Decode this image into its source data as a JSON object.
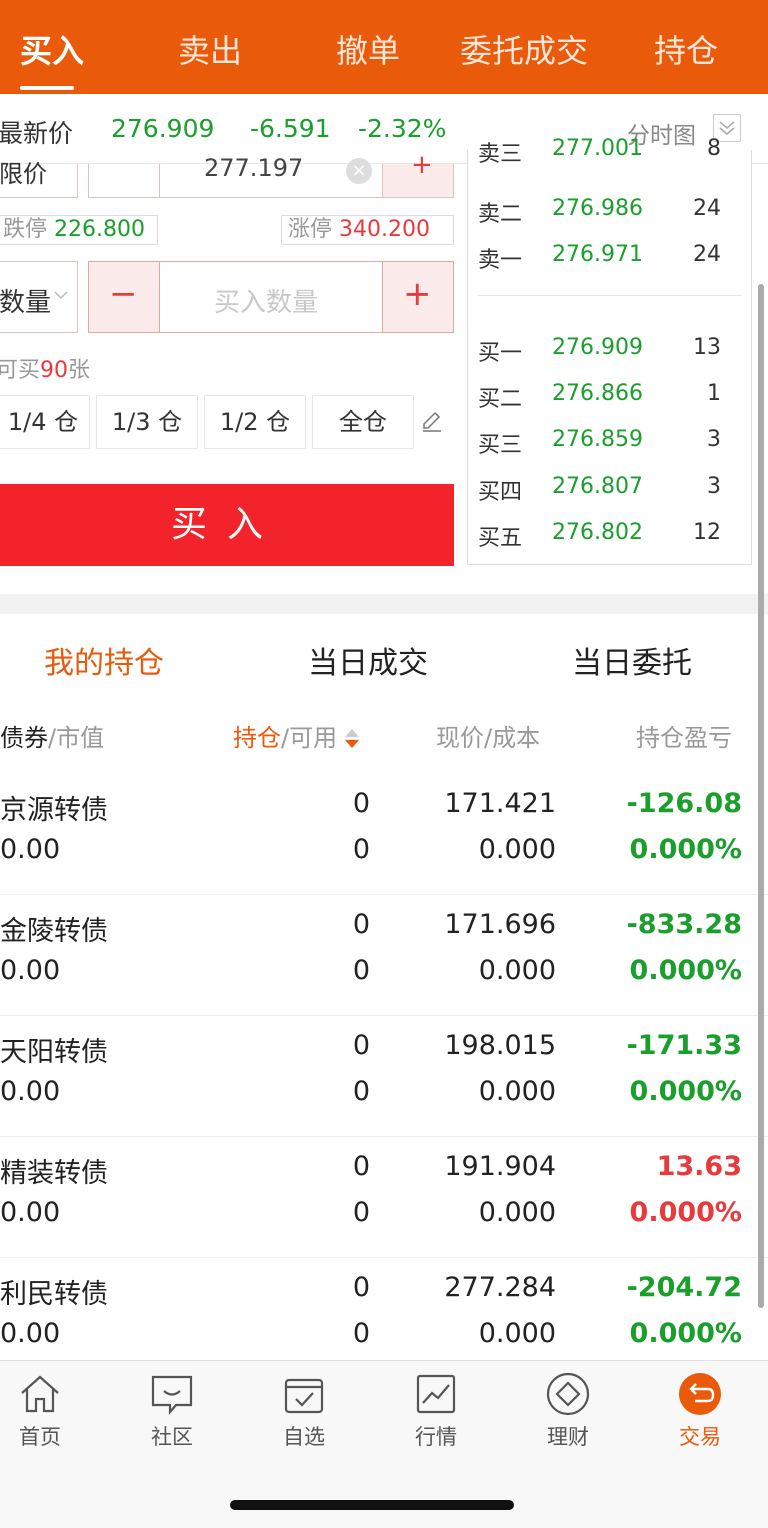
{
  "top_tabs": [
    "买入",
    "卖出",
    "撤单",
    "委托成交",
    "持仓"
  ],
  "quote": {
    "label": "最新价",
    "price": "276.909",
    "change": "-6.591",
    "change_pct": "-2.32%",
    "chart_link": "分时图"
  },
  "order_form": {
    "price_type": "限价",
    "price_value": "277.197",
    "clear_symbol": "×",
    "minus_symbol": "−",
    "plus_symbol": "+",
    "limit_down_label": "跌停",
    "limit_down_value": "226.800",
    "limit_up_label": "涨停",
    "limit_up_value": "340.200",
    "qty_type": "数量",
    "qty_placeholder": "买入数量",
    "can_buy_prefix": "可买",
    "can_buy_count": "90",
    "can_buy_unit": "张",
    "ratios": [
      "1/4 仓",
      "1/3 仓",
      "1/2 仓",
      "全仓"
    ],
    "buy_button": "买入"
  },
  "order_book": {
    "asks": [
      {
        "label": "卖三",
        "price": "277.001",
        "volume": "8"
      },
      {
        "label": "卖二",
        "price": "276.986",
        "volume": "24"
      },
      {
        "label": "卖一",
        "price": "276.971",
        "volume": "24"
      }
    ],
    "bids": [
      {
        "label": "买一",
        "price": "276.909",
        "volume": "13"
      },
      {
        "label": "买二",
        "price": "276.866",
        "volume": "1"
      },
      {
        "label": "买三",
        "price": "276.859",
        "volume": "3"
      },
      {
        "label": "买四",
        "price": "276.807",
        "volume": "3"
      },
      {
        "label": "买五",
        "price": "276.802",
        "volume": "12"
      }
    ]
  },
  "holdings": {
    "tabs": [
      "我的持仓",
      "当日成交",
      "当日委托"
    ],
    "headers": {
      "bond": "债券",
      "mkt_value": "市值",
      "position": "持仓",
      "available": "可用",
      "price": "现价",
      "cost": "成本",
      "pl": "持仓盈亏",
      "sep": "/"
    },
    "rows": [
      {
        "name": "京源转债",
        "mkt_value": "0.00",
        "position": "0",
        "available": "0",
        "price": "171.421",
        "cost": "0.000",
        "pl": "-126.08",
        "pl_pct": "0.000%",
        "sign": "neg"
      },
      {
        "name": "金陵转债",
        "mkt_value": "0.00",
        "position": "0",
        "available": "0",
        "price": "171.696",
        "cost": "0.000",
        "pl": "-833.28",
        "pl_pct": "0.000%",
        "sign": "neg"
      },
      {
        "name": "天阳转债",
        "mkt_value": "0.00",
        "position": "0",
        "available": "0",
        "price": "198.015",
        "cost": "0.000",
        "pl": "-171.33",
        "pl_pct": "0.000%",
        "sign": "neg"
      },
      {
        "name": "精装转债",
        "mkt_value": "0.00",
        "position": "0",
        "available": "0",
        "price": "191.904",
        "cost": "0.000",
        "pl": "13.63",
        "pl_pct": "0.000%",
        "sign": "pos"
      },
      {
        "name": "利民转债",
        "mkt_value": "0.00",
        "position": "0",
        "available": "0",
        "price": "277.284",
        "cost": "0.000",
        "pl": "-204.72",
        "pl_pct": "0.000%",
        "sign": "neg"
      }
    ]
  },
  "bottom_nav": [
    {
      "label": "首页",
      "icon": "home-icon"
    },
    {
      "label": "社区",
      "icon": "chat-icon"
    },
    {
      "label": "自选",
      "icon": "watchlist-icon"
    },
    {
      "label": "行情",
      "icon": "market-chart-icon"
    },
    {
      "label": "理财",
      "icon": "wealth-diamond-icon"
    },
    {
      "label": "交易",
      "icon": "trade-exchange-icon",
      "active": true
    }
  ],
  "colors": {
    "brand": "#ea5a0b",
    "up": "#e83a3a",
    "down": "#1a9e2c",
    "buy_button": "#f2232a"
  }
}
